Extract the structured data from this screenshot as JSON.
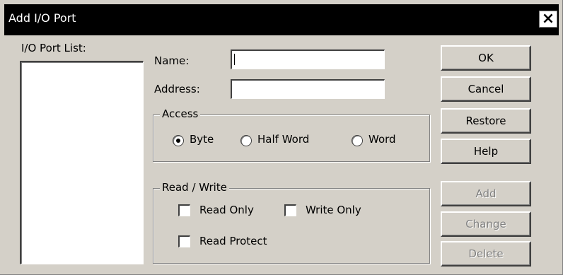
{
  "window": {
    "title": "Add I/O Port",
    "close_glyph": "×"
  },
  "port_list": {
    "label": "I/O Port List:",
    "items": []
  },
  "fields": {
    "name": {
      "label": "Name:",
      "value": ""
    },
    "address": {
      "label": "Address:",
      "value": ""
    }
  },
  "access": {
    "legend": "Access",
    "options": [
      {
        "label": "Byte",
        "selected": true
      },
      {
        "label": "Half Word",
        "selected": false
      },
      {
        "label": "Word",
        "selected": false
      }
    ]
  },
  "read_write": {
    "legend": "Read / Write",
    "options": [
      {
        "label": "Read Only",
        "checked": false
      },
      {
        "label": "Write Only",
        "checked": false
      },
      {
        "label": "Read Protect",
        "checked": false
      }
    ]
  },
  "buttons": {
    "ok": "OK",
    "cancel": "Cancel",
    "restore": "Restore",
    "help": "Help",
    "add": "Add",
    "change": "Change",
    "delete": "Delete"
  },
  "colors": {
    "dialog_bg": "#d4d0c8",
    "titlebar_bg": "#000000",
    "disabled_text": "#808080"
  }
}
